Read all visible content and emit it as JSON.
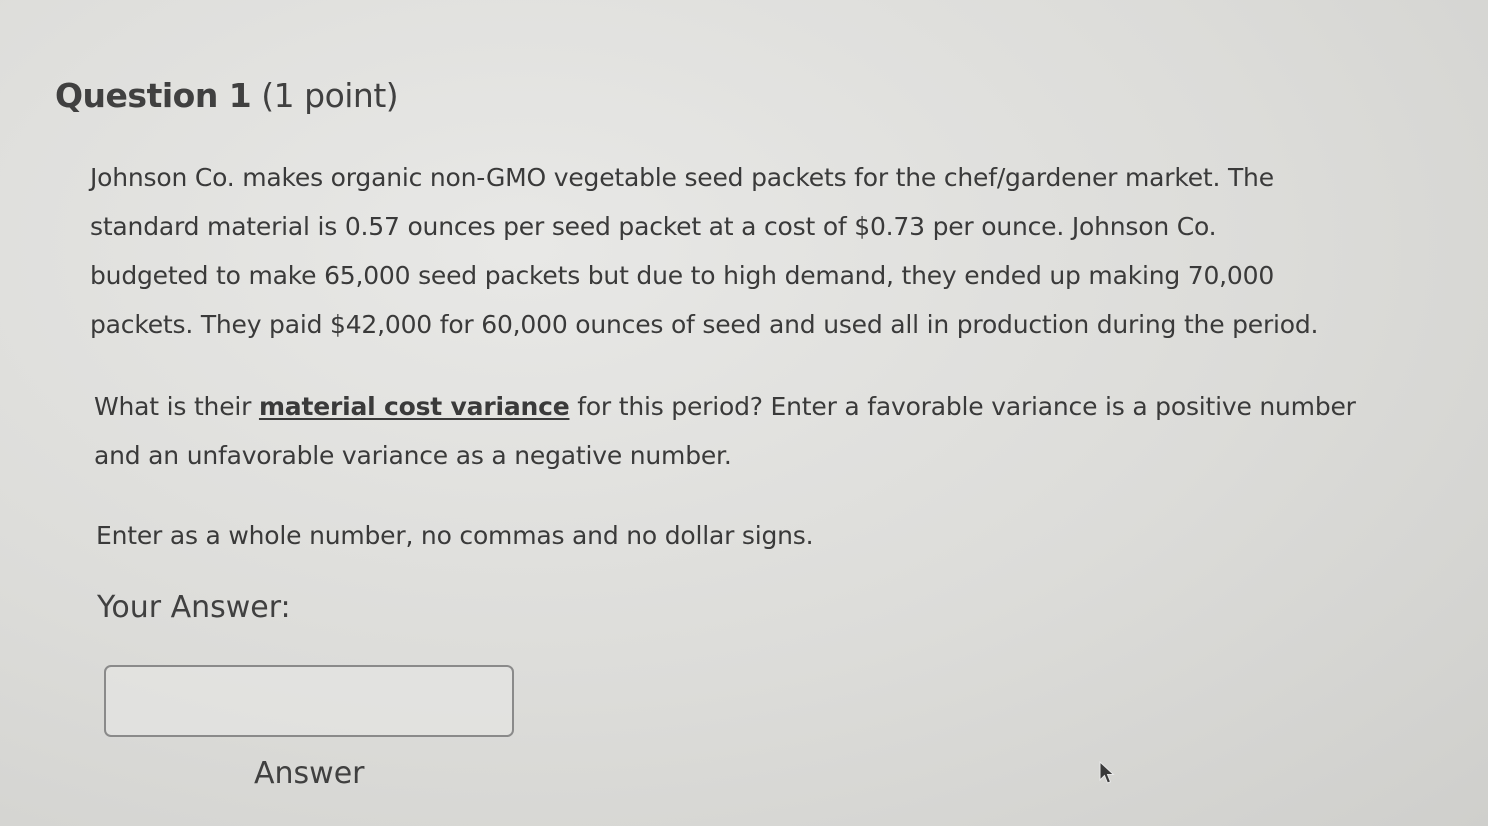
{
  "question": {
    "label": "Question 1",
    "points": " (1 point)"
  },
  "body": {
    "paragraph1_lines": [
      "Johnson Co. makes organic non-GMO vegetable seed packets for the chef/gardener market.  The",
      "standard material is 0.57 ounces per seed packet at a cost of $0.73 per ounce.  Johnson Co.",
      "budgeted to make 65,000 seed packets but due to high demand, they ended up making 70,000",
      "packets.  They paid $42,000 for 60,000 ounces of seed and used all in production during the period."
    ],
    "paragraph2": {
      "prefix": "What is their ",
      "term": "material cost variance",
      "suffix_line1": " for this period?   Enter a favorable variance is a positive number",
      "line2": "and an unfavorable variance as a negative number."
    },
    "paragraph3": "Enter as a whole number, no commas and no dollar signs."
  },
  "answer": {
    "label": "Your Answer:",
    "value": "",
    "placeholder": "",
    "caption": "Answer"
  },
  "icons": {
    "cursor": "mouse-pointer-icon"
  }
}
